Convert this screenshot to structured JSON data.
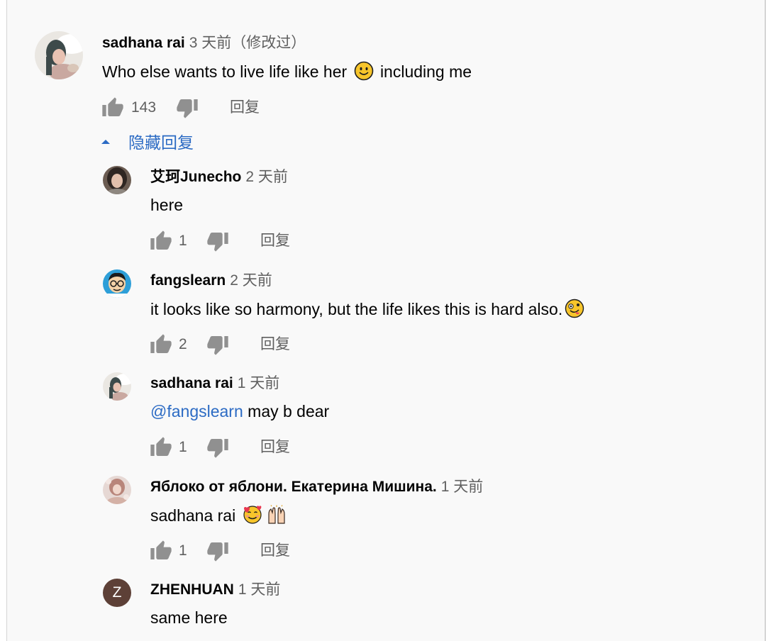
{
  "top_comment": {
    "author": "sadhana rai",
    "time": "3 天前（修改过）",
    "text_before": "Who else wants to live life like her",
    "emoji": "slightly-smiling-face",
    "text_after": "including me",
    "likes": "143",
    "reply_label": "回复"
  },
  "replies_toggle": {
    "label": "隐藏回复"
  },
  "replies": [
    {
      "author": "艾珂Junecho",
      "time": "2 天前",
      "text": "here",
      "likes": "1",
      "reply_label": "回复"
    },
    {
      "author": "fangslearn",
      "time": "2 天前",
      "text": "it looks like so harmony, but the life likes this is hard also.",
      "emoji": "zany-face",
      "likes": "2",
      "reply_label": "回复"
    },
    {
      "author": "sadhana rai",
      "time": "1 天前",
      "mention": "@fangslearn",
      "text": "may b dear",
      "likes": "1",
      "reply_label": "回复"
    },
    {
      "author": "Яблоко от яблони. Екатерина Мишина.",
      "time": "1 天前",
      "text": "sadhana rai",
      "emojis": [
        "smiling-face-with-hearts",
        "raising-hands"
      ],
      "likes": "1",
      "reply_label": "回复"
    },
    {
      "author": "ZHENHUAN",
      "time": "1 天前",
      "text": "same here",
      "avatar_letter": "Z"
    }
  ],
  "colors": {
    "link_blue": "#2c6bc4",
    "meta_gray": "#606060",
    "icon_gray": "#909090",
    "avatar_brown": "#5d4037"
  }
}
